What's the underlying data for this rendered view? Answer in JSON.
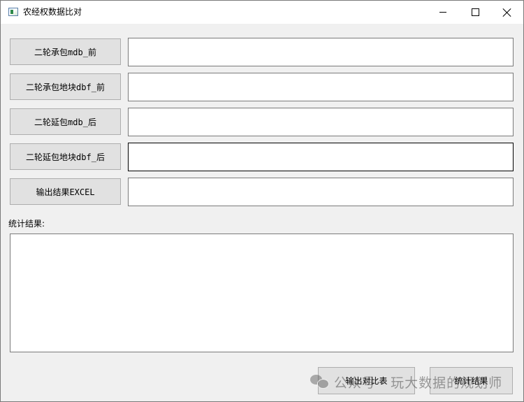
{
  "window": {
    "title": "农经权数据比对"
  },
  "buttons": {
    "contract_mdb_before": "二轮承包mdb_前",
    "contract_plot_dbf_before": "二轮承包地块dbf_前",
    "extension_mdb_after": "二轮延包mdb_后",
    "extension_plot_dbf_after": "二轮延包地块dbf_后",
    "output_excel": "输出结果EXCEL"
  },
  "inputs": {
    "contract_mdb_before": "",
    "contract_plot_dbf_before": "",
    "extension_mdb_after": "",
    "extension_plot_dbf_after": "",
    "output_excel": ""
  },
  "stats": {
    "label": "统计结果:",
    "content": ""
  },
  "actions": {
    "export_compare_table": "输出对比表",
    "compute_stats": "统计结果"
  },
  "watermark": {
    "text": "公众号 · 玩大数据的规划师"
  }
}
